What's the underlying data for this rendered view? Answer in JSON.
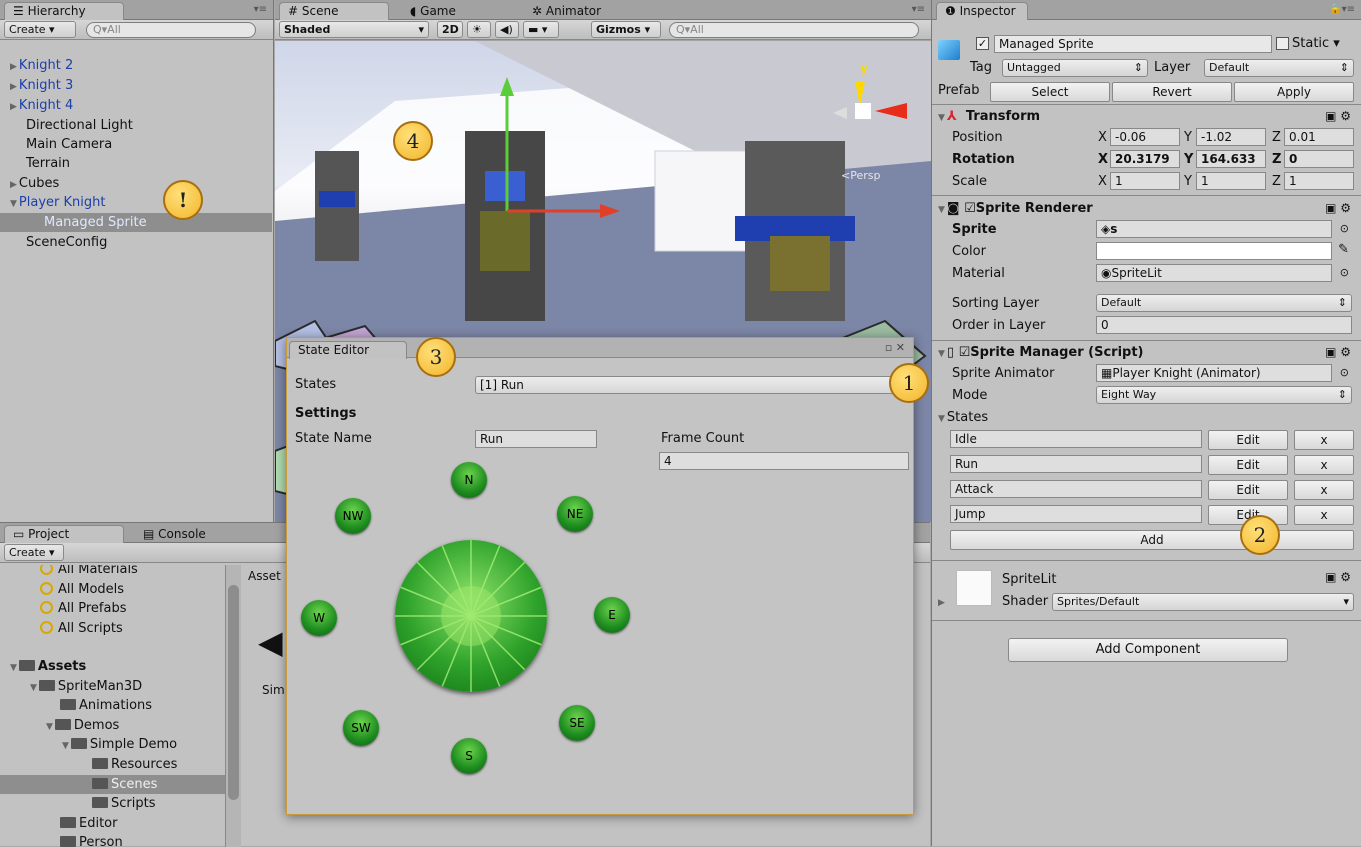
{
  "hierarchy": {
    "tab": "Hierarchy",
    "create": "Create",
    "search": "Q▾All",
    "items": [
      "Knight 2",
      "Knight 3",
      "Knight 4",
      "Directional Light",
      "Main Camera",
      "Terrain",
      "Cubes",
      "Player Knight",
      "Managed Sprite",
      "SceneConfig"
    ]
  },
  "scene": {
    "tabs": [
      "Scene",
      "Game",
      "Animator"
    ],
    "shading": "Shaded",
    "mode2d": "2D",
    "gizmos": "Gizmos",
    "search": "Q▾All",
    "persp": "<Persp",
    "axis_y": "y"
  },
  "project": {
    "tabs": [
      "Project",
      "Console"
    ],
    "create": "Create",
    "assets_header": "Asset",
    "item_label": "Sim",
    "favorites": [
      "All Materials",
      "All Models",
      "All Prefabs",
      "All Scripts"
    ],
    "tree": [
      "Assets",
      "SpriteMan3D",
      "Animations",
      "Demos",
      "Simple Demo",
      "Resources",
      "Scenes",
      "Scripts",
      "Editor",
      "Person"
    ]
  },
  "state_editor": {
    "tab": "State Editor",
    "states_label": "States",
    "states_value": "[1] Run",
    "settings": "Settings",
    "state_name_label": "State Name",
    "state_name_value": "Run",
    "frame_count_label": "Frame Count",
    "frame_count_value": "4",
    "directions": [
      "N",
      "NE",
      "E",
      "SE",
      "S",
      "SW",
      "W",
      "NW"
    ]
  },
  "inspector": {
    "tab": "Inspector",
    "object_name": "Managed Sprite",
    "static": "Static",
    "tag_label": "Tag",
    "tag_value": "Untagged",
    "layer_label": "Layer",
    "layer_value": "Default",
    "prefab_label": "Prefab",
    "select": "Select",
    "revert": "Revert",
    "apply": "Apply",
    "transform": {
      "title": "Transform",
      "position": "Position",
      "rotation": "Rotation",
      "scale": "Scale",
      "pos": [
        "-0.06",
        "-1.02",
        "0.01"
      ],
      "rot": [
        "20.3179",
        "164.633",
        "0"
      ],
      "scl": [
        "1",
        "1",
        "1"
      ],
      "axes": [
        "X",
        "Y",
        "Z"
      ]
    },
    "sprite_renderer": {
      "title": "Sprite Renderer",
      "sprite_label": "Sprite",
      "sprite_value": "s",
      "color_label": "Color",
      "material_label": "Material",
      "material_value": "SpriteLit",
      "sorting_label": "Sorting Layer",
      "sorting_value": "Default",
      "order_label": "Order in Layer",
      "order_value": "0"
    },
    "sprite_manager": {
      "title": "Sprite Manager (Script)",
      "animator_label": "Sprite Animator",
      "animator_value": "Player Knight (Animator)",
      "mode_label": "Mode",
      "mode_value": "Eight Way",
      "states_label": "States",
      "states": [
        "Idle",
        "Run",
        "Attack",
        "Jump"
      ],
      "edit": "Edit",
      "remove": "x",
      "add": "Add"
    },
    "material": {
      "name": "SpriteLit",
      "shader_label": "Shader",
      "shader_value": "Sprites/Default"
    },
    "add_component": "Add Component"
  },
  "callouts": [
    "!",
    "1",
    "2",
    "3",
    "4"
  ]
}
